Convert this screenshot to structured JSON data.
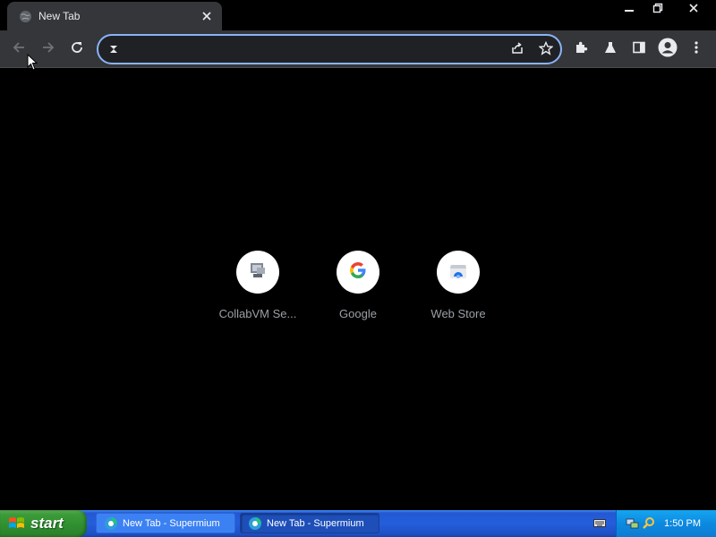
{
  "tab": {
    "title": "New Tab"
  },
  "omnibox": {
    "value": "",
    "placeholder": ""
  },
  "shortcuts": [
    {
      "label": "CollabVM Se...",
      "icon": "collabvm-icon"
    },
    {
      "label": "Google",
      "icon": "google-icon"
    },
    {
      "label": "Web Store",
      "icon": "web-store-icon"
    }
  ],
  "taskbar": {
    "start_label": "start",
    "tasks": [
      {
        "label": "New Tab - Supermium"
      },
      {
        "label": "New Tab - Supermium"
      }
    ],
    "clock": "1:50 PM"
  },
  "colors": {
    "accent": "#8ab4f8",
    "toolbar": "#35363a",
    "taskbar": "#245edb",
    "start": "#3c9c3a"
  }
}
